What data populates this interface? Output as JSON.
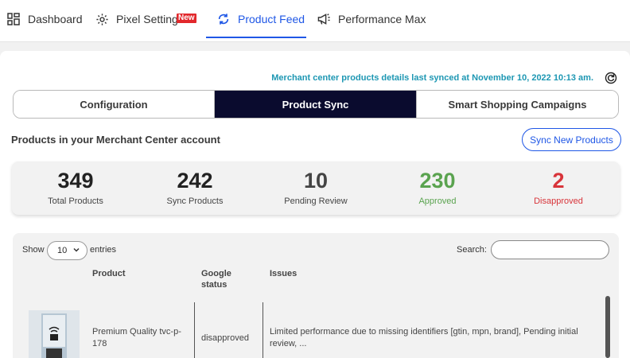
{
  "nav": {
    "items": [
      {
        "label": "Dashboard",
        "icon": "dashboard-grid-icon"
      },
      {
        "label": "Pixel Settings",
        "icon": "gear-icon",
        "badge": "New"
      },
      {
        "label": "Product Feed",
        "icon": "sync-icon",
        "active": true
      },
      {
        "label": "Performance Max",
        "icon": "megaphone-icon"
      }
    ]
  },
  "sync_info": "Merchant center products details last synced at November 10, 2022 10:13 am.",
  "tabs": [
    "Configuration",
    "Product Sync",
    "Smart Shopping Campaigns"
  ],
  "section_title": "Products in your Merchant Center account",
  "sync_button": "Sync New Products",
  "stats": [
    {
      "value": "349",
      "label": "Total Products",
      "color": "#222222"
    },
    {
      "value": "242",
      "label": "Sync Products",
      "color": "#222222"
    },
    {
      "value": "10",
      "label": "Pending Review",
      "color": "#444444"
    },
    {
      "value": "230",
      "label": "Approved",
      "color": "#5aa34f"
    },
    {
      "value": "2",
      "label": "Disapproved",
      "color": "#d8343a"
    }
  ],
  "table": {
    "show_label": "Show",
    "entries_value": "10",
    "entries_label": "entries",
    "search_label": "Search:",
    "headers": [
      "Product",
      "Google status",
      "Issues"
    ],
    "rows": [
      {
        "product": "Premium Quality tvc-p-178",
        "status": "disapproved",
        "issues": "Limited performance due to missing identifiers [gtin, mpn, brand], Pending initial review, ..."
      }
    ]
  },
  "colors": {
    "accent": "#1f57e6",
    "active_tab_bg": "#0a0b2e",
    "sync_info": "#1d97b3",
    "badge": "#e2282c"
  }
}
